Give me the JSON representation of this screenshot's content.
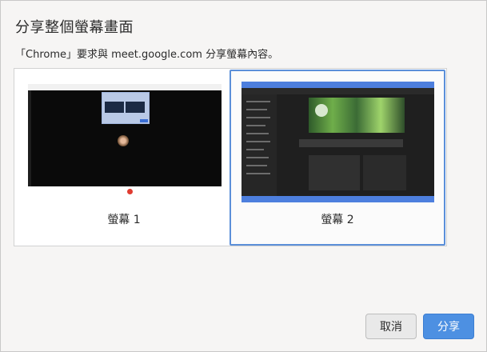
{
  "dialog": {
    "title": "分享整個螢幕畫面",
    "subtitle": "「Chrome」要求與 meet.google.com 分享螢幕內容。"
  },
  "sources": [
    {
      "label": "螢幕 1",
      "selected": false
    },
    {
      "label": "螢幕 2",
      "selected": true
    }
  ],
  "buttons": {
    "cancel": "取消",
    "share": "分享"
  },
  "colors": {
    "accent": "#4d90e2",
    "selected_border": "#5b8fd9"
  }
}
